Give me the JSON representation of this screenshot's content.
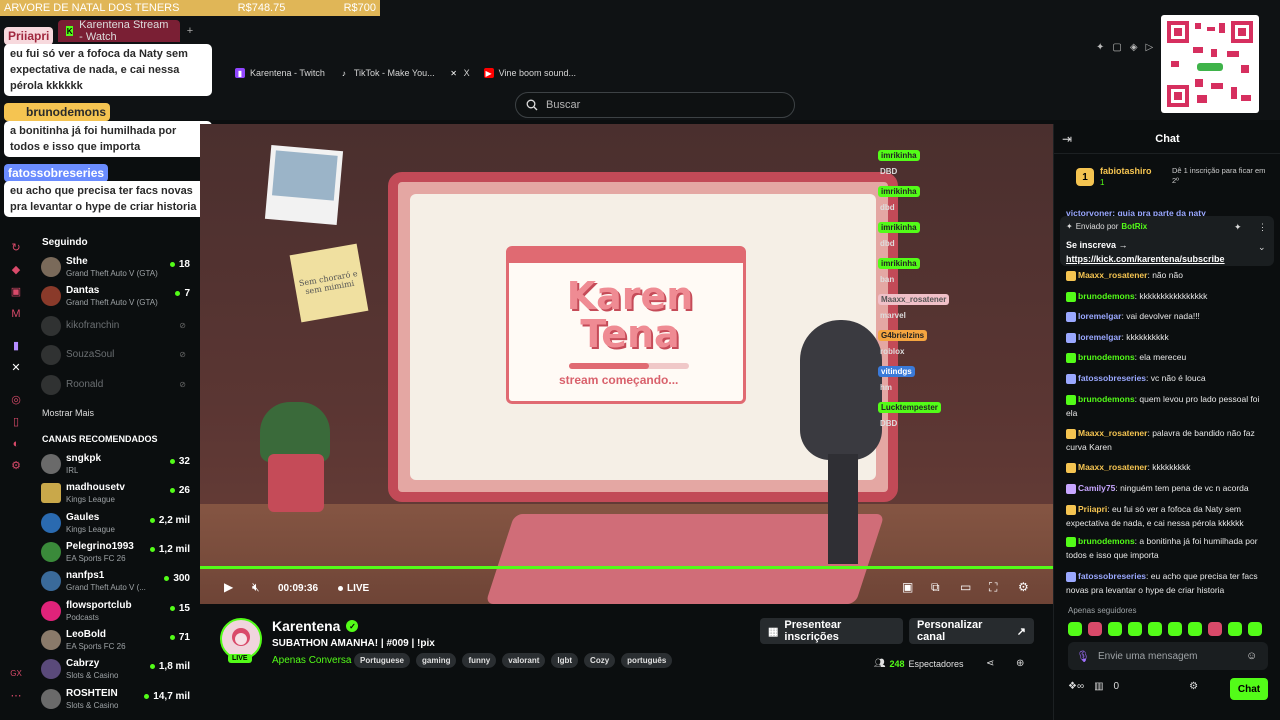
{
  "donation": {
    "left": "ARVORE DE NATAL DOS TENERS",
    "middle": "R$748.75",
    "right": "R$700"
  },
  "tabs": {
    "active": "Karentena Stream - Watch",
    "new": "+"
  },
  "bookmarks": [
    {
      "label": "Karentena - Twitch"
    },
    {
      "label": "TikTok - Make You..."
    },
    {
      "label": "X"
    },
    {
      "label": "Vine boom sound..."
    }
  ],
  "search": {
    "placeholder": "Buscar"
  },
  "overlay": [
    {
      "name": "Priiapri",
      "msg": "eu fui só ver a fofoca da Naty sem expectativa de nada, e cai nessa pérola kkkkkk"
    },
    {
      "name": "brunodemons",
      "msg": "a bonitinha já foi humilhada por todos e isso que importa"
    },
    {
      "name": "fatossobreseries",
      "msg": "eu acho que precisa ter facs novas pra levantar o hype de criar historia"
    }
  ],
  "sidebar": {
    "following_label": "Seguindo",
    "following": [
      {
        "name": "Sthe",
        "cat": "Grand Theft Auto V (GTA)",
        "count": "18"
      },
      {
        "name": "Dantas",
        "cat": "Grand Theft Auto V (GTA)",
        "count": "7"
      },
      {
        "name": "kikofranchin"
      },
      {
        "name": "SouzaSoul"
      },
      {
        "name": "Roonald"
      }
    ],
    "show_more": "Mostrar Mais",
    "recommended_label": "CANAIS RECOMENDADOS",
    "recommended": [
      {
        "name": "sngkpk",
        "cat": "IRL",
        "count": "32"
      },
      {
        "name": "madhousetv",
        "cat": "Kings League",
        "count": "26"
      },
      {
        "name": "Gaules",
        "cat": "Kings League",
        "count": "2,2 mil"
      },
      {
        "name": "Pelegrino1993",
        "cat": "EA Sports FC 26",
        "count": "1,2 mil"
      },
      {
        "name": "nanfps1",
        "cat": "Grand Theft Auto V (...",
        "count": "300"
      },
      {
        "name": "flowsportclub",
        "cat": "Podcasts",
        "count": "15"
      },
      {
        "name": "LeoBold",
        "cat": "EA Sports FC 26",
        "count": "71"
      },
      {
        "name": "Cabrzy",
        "cat": "Slots & Casino",
        "count": "1,8 mil"
      },
      {
        "name": "ROSHTEIN",
        "cat": "Slots & Casino",
        "count": "14,7 mil"
      }
    ]
  },
  "scene": {
    "logo": "Karen Tena",
    "loading": "stream começando...",
    "sticky": "Sem choraró e sem mimimi",
    "stream_chat": [
      {
        "name": "imrikinha",
        "msg": "DBD"
      },
      {
        "name": "imrikinha",
        "msg": "dbd"
      },
      {
        "name": "imrikinha",
        "msg": "dbd"
      },
      {
        "name": "imrikinha",
        "msg": "ban"
      },
      {
        "name": "Maaxx_rosatener",
        "msg": "marvel"
      },
      {
        "name": "G4brielzins",
        "msg": "roblox"
      },
      {
        "name": "vitindgs",
        "msg": "hm"
      },
      {
        "name": "Lucktempester",
        "msg": "DBD"
      }
    ]
  },
  "player": {
    "time": "00:09:36",
    "live": "LIVE",
    "progress": 1.0
  },
  "streamer": {
    "name": "Karentena",
    "live": "LIVE",
    "title": "SUBATHON AMANHA! | #009 | !pix",
    "category": "Apenas Conversa",
    "tags": [
      "Portuguese",
      "gaming",
      "funny",
      "valorant",
      "lgbt",
      "Cozy",
      "português"
    ],
    "gift_button": "Presentear inscrições",
    "customize_button": "Personalizar canal",
    "viewers": "248",
    "viewers_label": "Espectadores"
  },
  "chat": {
    "title": "Chat",
    "gift_user": "fabiotashiro",
    "gift_badge": "1",
    "gift_text": "Dê 1 inscrição para ficar em 2º",
    "pinned_by": "Enviado por",
    "pinned_bot": "BotRix",
    "pinned_line1": "Se inscreva →",
    "pinned_link": "https://kick.com/karentena/subscribe",
    "partial": "victorvoner: quia pra parte da naty",
    "messages": [
      {
        "user": "Maaxx_rosatener",
        "text": "não não",
        "color": "#f5c451"
      },
      {
        "user": "brunodemons",
        "text": "kkkkkkkkkkkkkkkk",
        "color": "#53fc18"
      },
      {
        "user": "loremelgar",
        "text": "vai devolver nada!!!",
        "color": "#9aa8ff"
      },
      {
        "user": "loremelgar",
        "text": "kkkkkkkkkk",
        "color": "#9aa8ff"
      },
      {
        "user": "brunodemons",
        "text": "ela mereceu",
        "color": "#53fc18"
      },
      {
        "user": "fatossobreseries",
        "text": "vc não é louca",
        "color": "#9aa8ff"
      },
      {
        "user": "brunodemons",
        "text": "quem levou pro lado pessoal foi ela",
        "color": "#53fc18"
      },
      {
        "user": "Maaxx_rosatener",
        "text": "palavra de bandido não faz curva Karen",
        "color": "#f5c451"
      },
      {
        "user": "Maaxx_rosatener",
        "text": "kkkkkkkkk",
        "color": "#f5c451"
      },
      {
        "user": "Camily75",
        "text": "ninguém tem pena de vc n acorda",
        "color": "#c7a6ff"
      },
      {
        "user": "Priiapri",
        "text": "eu fui só ver a fofoca da Naty sem expectativa de nada, e cai nessa pérola kkkkkk",
        "color": "#f5c451"
      },
      {
        "user": "brunodemons",
        "text": "a bonitinha já foi humilhada por todos e isso que importa",
        "color": "#53fc18"
      },
      {
        "user": "fatossobreseries",
        "text": "eu acho que precisa ter facs novas pra levantar o hype de criar historia",
        "color": "#9aa8ff"
      }
    ],
    "followers_only": "Apenas seguidores",
    "input_placeholder": "Envie uma mensagem",
    "send": "Chat",
    "bottom_count": "0"
  }
}
